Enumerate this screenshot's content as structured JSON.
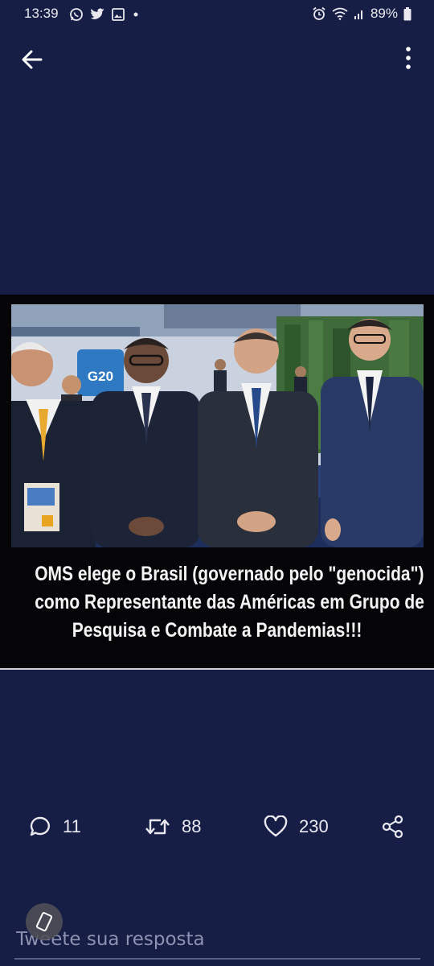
{
  "status_bar": {
    "time": "13:39",
    "battery": "89%",
    "left_icons": [
      "whatsapp-icon",
      "twitter-icon",
      "gallery-icon",
      "dot-icon"
    ],
    "right_icons": [
      "alarm-icon",
      "wifi-icon",
      "signal-icon",
      "battery-icon"
    ]
  },
  "top_bar": {
    "back_icon": "arrow-left-icon",
    "more_icon": "more-vertical-icon"
  },
  "media": {
    "photo_banner_text": "G20",
    "caption_lines": [
      "OMS elege o Brasil (governado pelo \"genocida\")",
      "como Representante das Américas em Grupo de",
      "Pesquisa e Combate a Pandemias!!!"
    ]
  },
  "actions": {
    "reply_count": "11",
    "retweet_count": "88",
    "like_count": "230"
  },
  "reply": {
    "placeholder": "Tweete sua resposta"
  },
  "colors": {
    "background": "#161e46",
    "media_background": "#050507",
    "text": "#e8e8ee",
    "placeholder": "#8d92b0"
  }
}
